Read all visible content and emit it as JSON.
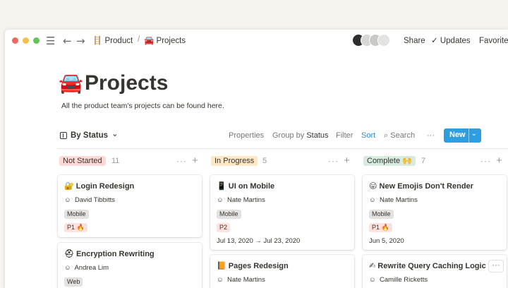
{
  "topbar": {
    "menu_icon": "☰",
    "back_icon": "←",
    "forward_icon": "→",
    "crumb_product_emoji": "🪜",
    "crumb_product": "Product",
    "crumb_sep": "/",
    "crumb_projects_emoji": "🚘",
    "crumb_projects": "Projects",
    "share": "Share",
    "updates_icon": "✓",
    "updates": "Updates",
    "favorite": "Favorite"
  },
  "page": {
    "emoji": "🚘",
    "title": "Projects",
    "description": "All the product team's projects can be found here."
  },
  "toolbar": {
    "view_label": "By Status",
    "view_chevron": "⌄",
    "properties": "Properties",
    "group_by": "Group by",
    "group_by_value": "Status",
    "filter": "Filter",
    "sort": "Sort",
    "search_icon": "⌕",
    "search": "Search",
    "more": "···",
    "new_button": "New",
    "new_chevron": "⌄"
  },
  "columns": [
    {
      "status": "Not Started",
      "count": "11",
      "more": "···",
      "add": "+",
      "cards": [
        {
          "emoji": "🔐",
          "title": "Login Redesign",
          "person_icon": "☺",
          "person": "David Tibbitts",
          "tag": "Mobile",
          "priority": "P1 🔥"
        },
        {
          "emoji": "⛑",
          "title": "Encryption Rewriting",
          "person_icon": "☺",
          "person": "Andrea Lim",
          "tag": "Web"
        }
      ]
    },
    {
      "status": "In Progress",
      "count": "5",
      "more": "···",
      "add": "+",
      "cards": [
        {
          "emoji": "📱",
          "title": "UI on Mobile",
          "person_icon": "☺",
          "person": "Nate Martins",
          "tag": "Mobile",
          "priority": "P2",
          "date": "Jul 13, 2020 → Jul 23, 2020"
        },
        {
          "emoji": "📙",
          "title": "Pages Redesign",
          "person_icon": "☺",
          "person": "Nate Martins"
        }
      ]
    },
    {
      "status": "Complete 🙌",
      "count": "7",
      "more": "···",
      "add": "+",
      "cards": [
        {
          "emoji": "😛",
          "title": "New Emojis Don't Render",
          "person_icon": "☺",
          "person": "Nate Martins",
          "tag": "Mobile",
          "priority": "P1 🔥",
          "date": "Jun 5, 2020"
        },
        {
          "emoji": "✍",
          "title": "Rewrite Query Caching Logic",
          "person_icon": "☺",
          "person": "Camille Ricketts",
          "more": "···"
        }
      ]
    }
  ]
}
